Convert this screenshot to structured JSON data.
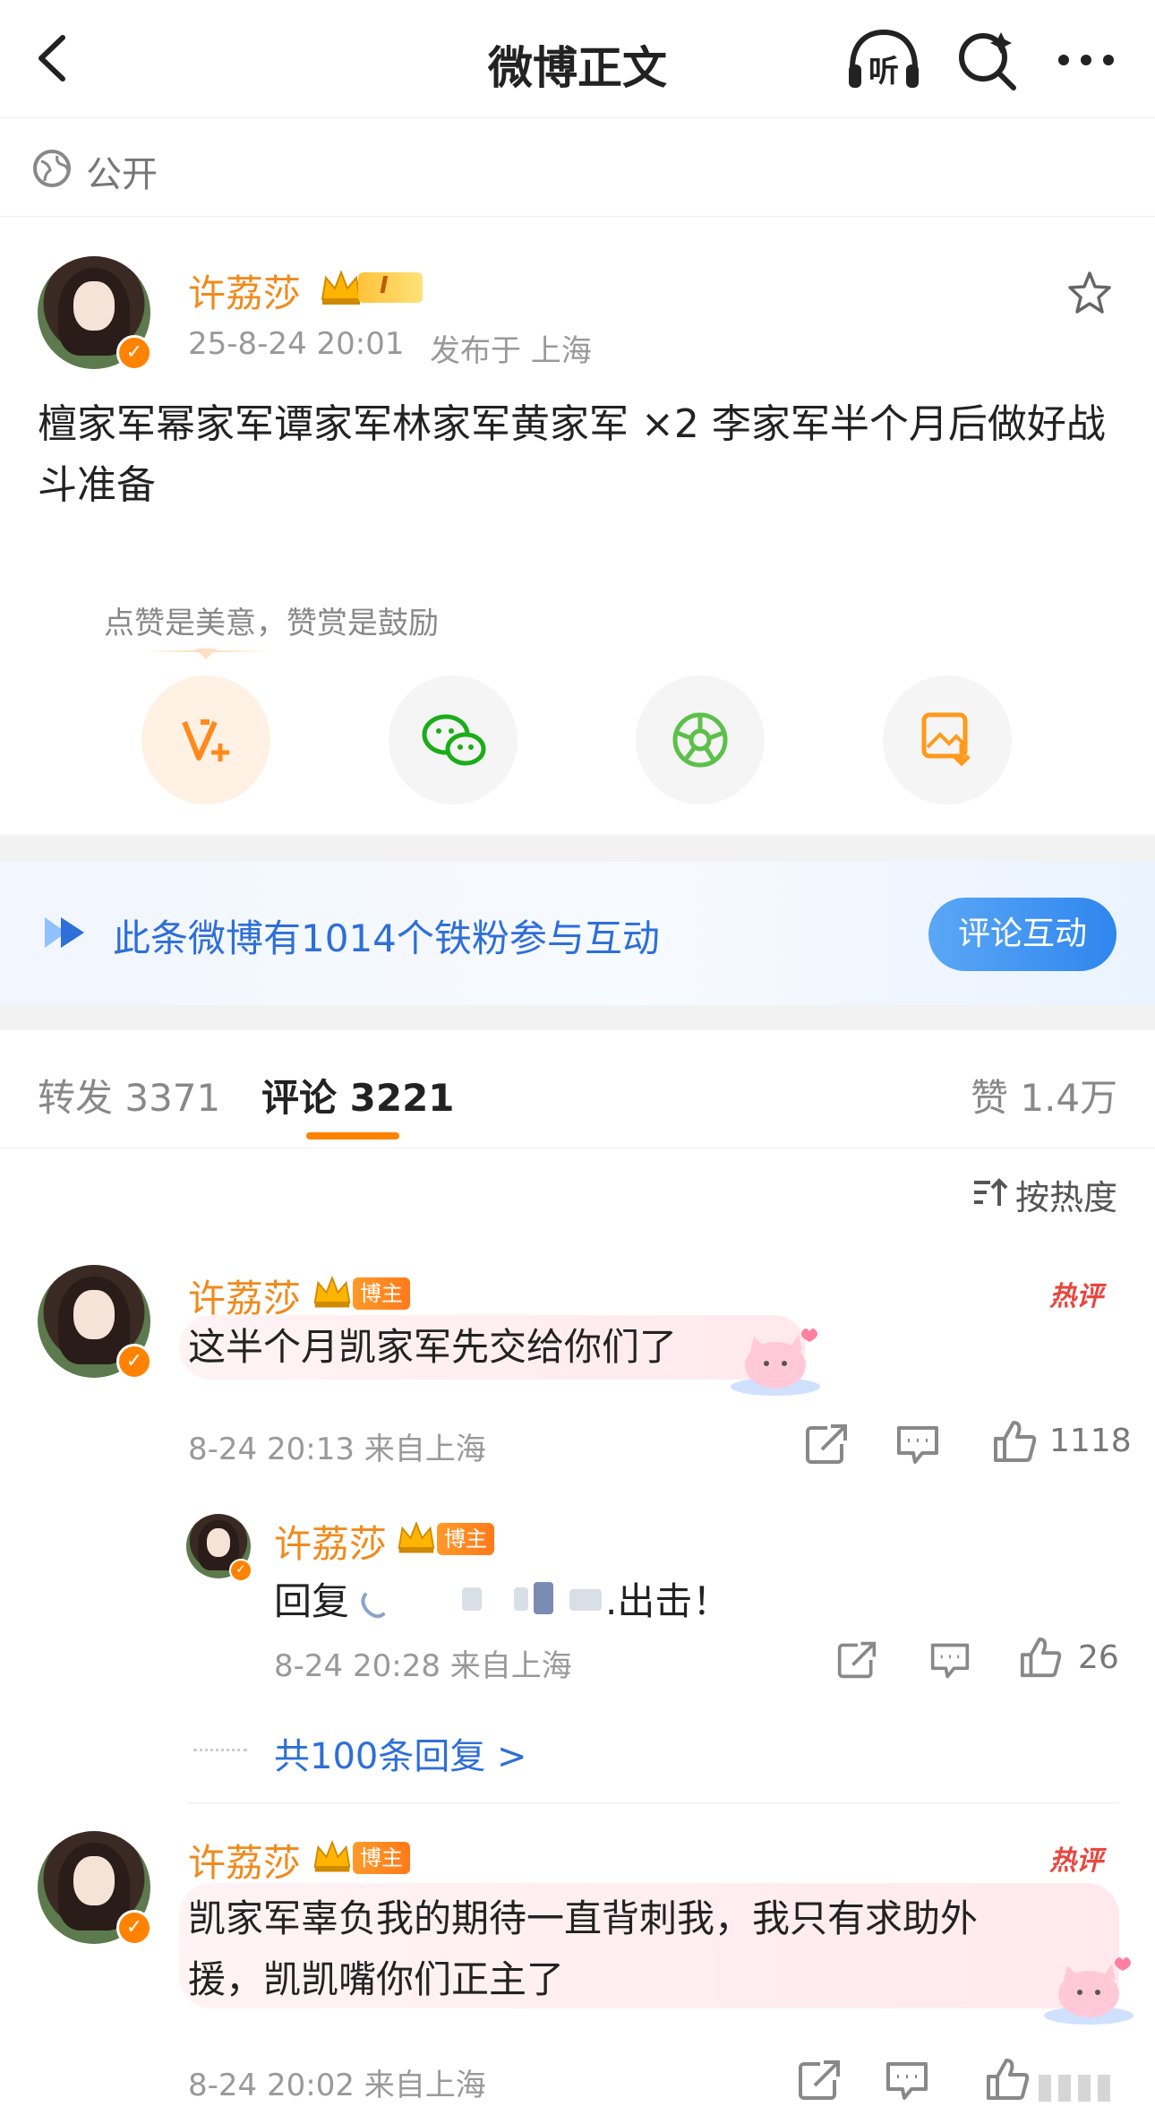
{
  "nav": {
    "title": "微博正文",
    "listen_label": "听"
  },
  "visibility": {
    "label": "公开"
  },
  "post": {
    "author": "许荔莎",
    "level_badge": "I",
    "time": "25-8-24 20:01",
    "location": "发布于 上海",
    "text": "檀家军幂家军谭家军林家军黄家军 ×2 李家军半个月后做好战斗准备",
    "reward_tip": "点赞是美意，赞赏是鼓励"
  },
  "fans_band": {
    "text": "此条微博有1014个铁粉参与互动",
    "button": "评论互动"
  },
  "tabs": {
    "repost": "转发 3371",
    "comment": "评论 3221",
    "like": "赞 1.4万"
  },
  "sort_label": "按热度",
  "comments": [
    {
      "author": "许荔莎",
      "tag": "博主",
      "hot_label": "热评",
      "text": "这半个月凯家军先交给你们了",
      "time": "8-24 20:13 来自上海",
      "likes": "1118",
      "reply": {
        "author": "许荔莎",
        "tag": "博主",
        "prefix": "回复",
        "suffix": ".出击！",
        "time": "8-24 20:28 来自上海",
        "likes": "26"
      },
      "more_replies": "共100条回复 >"
    },
    {
      "author": "许荔莎",
      "tag": "博主",
      "hot_label": "热评",
      "text_line1": "凯家军辜负我的期待一直背刺我，我只有求助外",
      "text_line2": "援，凯凯嘴你们正主了",
      "time": "8-24 20:02 来自上海"
    }
  ],
  "colors": {
    "accent_orange": "#ff8200",
    "link_blue": "#2e6fd8",
    "hot_red": "#e8473f",
    "wechat_green": "#1aad19"
  },
  "icons": [
    "back-icon",
    "headphone-icon",
    "search-icon",
    "more-icon",
    "globe-icon",
    "star-icon",
    "reward-icon",
    "wechat-icon",
    "moments-icon",
    "save-image-icon",
    "fans-icon",
    "sort-icon",
    "share-icon",
    "comment-icon",
    "like-icon"
  ]
}
